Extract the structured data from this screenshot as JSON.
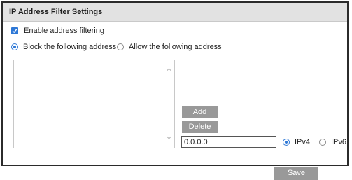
{
  "panel": {
    "title": "IP Address Filter Settings"
  },
  "enable_filter": {
    "label": "Enable address filtering",
    "checked": true
  },
  "filter_mode": {
    "block_label": "Block the following address",
    "allow_label": "Allow the following address",
    "selected": "block"
  },
  "address_list": {
    "items": []
  },
  "buttons": {
    "add_label": "Add",
    "delete_label": "Delete",
    "save_label": "Save"
  },
  "ip_input": {
    "value": "0.0.0.0"
  },
  "ip_version": {
    "ipv4_label": "IPv4",
    "ipv6_label": "IPv6",
    "selected": "ipv4"
  },
  "colors": {
    "accent": "#2e78d6",
    "button_bg": "#999999",
    "header_bg": "#e2e2e2"
  }
}
